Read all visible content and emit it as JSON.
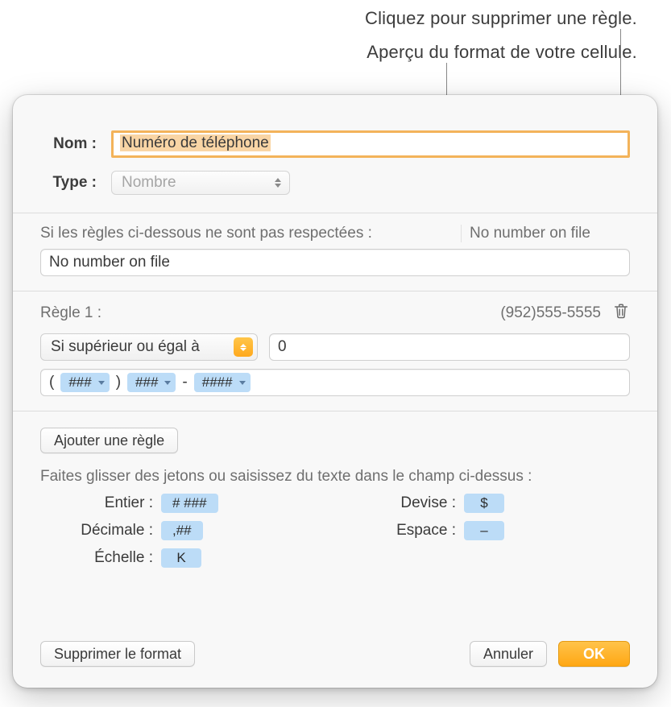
{
  "callouts": {
    "delete_rule": "Cliquez pour supprimer une règle.",
    "format_preview": "Aperçu du format de votre cellule."
  },
  "form": {
    "name_label": "Nom :",
    "name_value": "Numéro de téléphone",
    "type_label": "Type :",
    "type_value": "Nombre"
  },
  "rules_intro": {
    "left": "Si les règles ci-dessous ne sont pas respectées :",
    "right": "No number on file",
    "default_value": "No number on file"
  },
  "rule1": {
    "title": "Règle 1 :",
    "preview": "(952)555-5555",
    "condition_label": "Si supérieur ou égal à",
    "condition_value": "0",
    "format_tokens": {
      "open": "(",
      "t1": "###",
      "close": ")",
      "t2": "###",
      "dash": "-",
      "t3": "####"
    }
  },
  "add_rule": "Ajouter une règle",
  "tokens_help": "Faites glisser des jetons ou saisissez du texte dans le champ ci-dessus :",
  "tokens": {
    "entier_label": "Entier :",
    "entier_value": "# ###",
    "decimale_label": "Décimale :",
    "decimale_value": ",##",
    "echelle_label": "Échelle :",
    "echelle_value": "K",
    "devise_label": "Devise :",
    "devise_value": "$",
    "espace_label": "Espace :",
    "espace_value": "–"
  },
  "footer": {
    "delete_format": "Supprimer le format",
    "cancel": "Annuler",
    "ok": "OK"
  }
}
